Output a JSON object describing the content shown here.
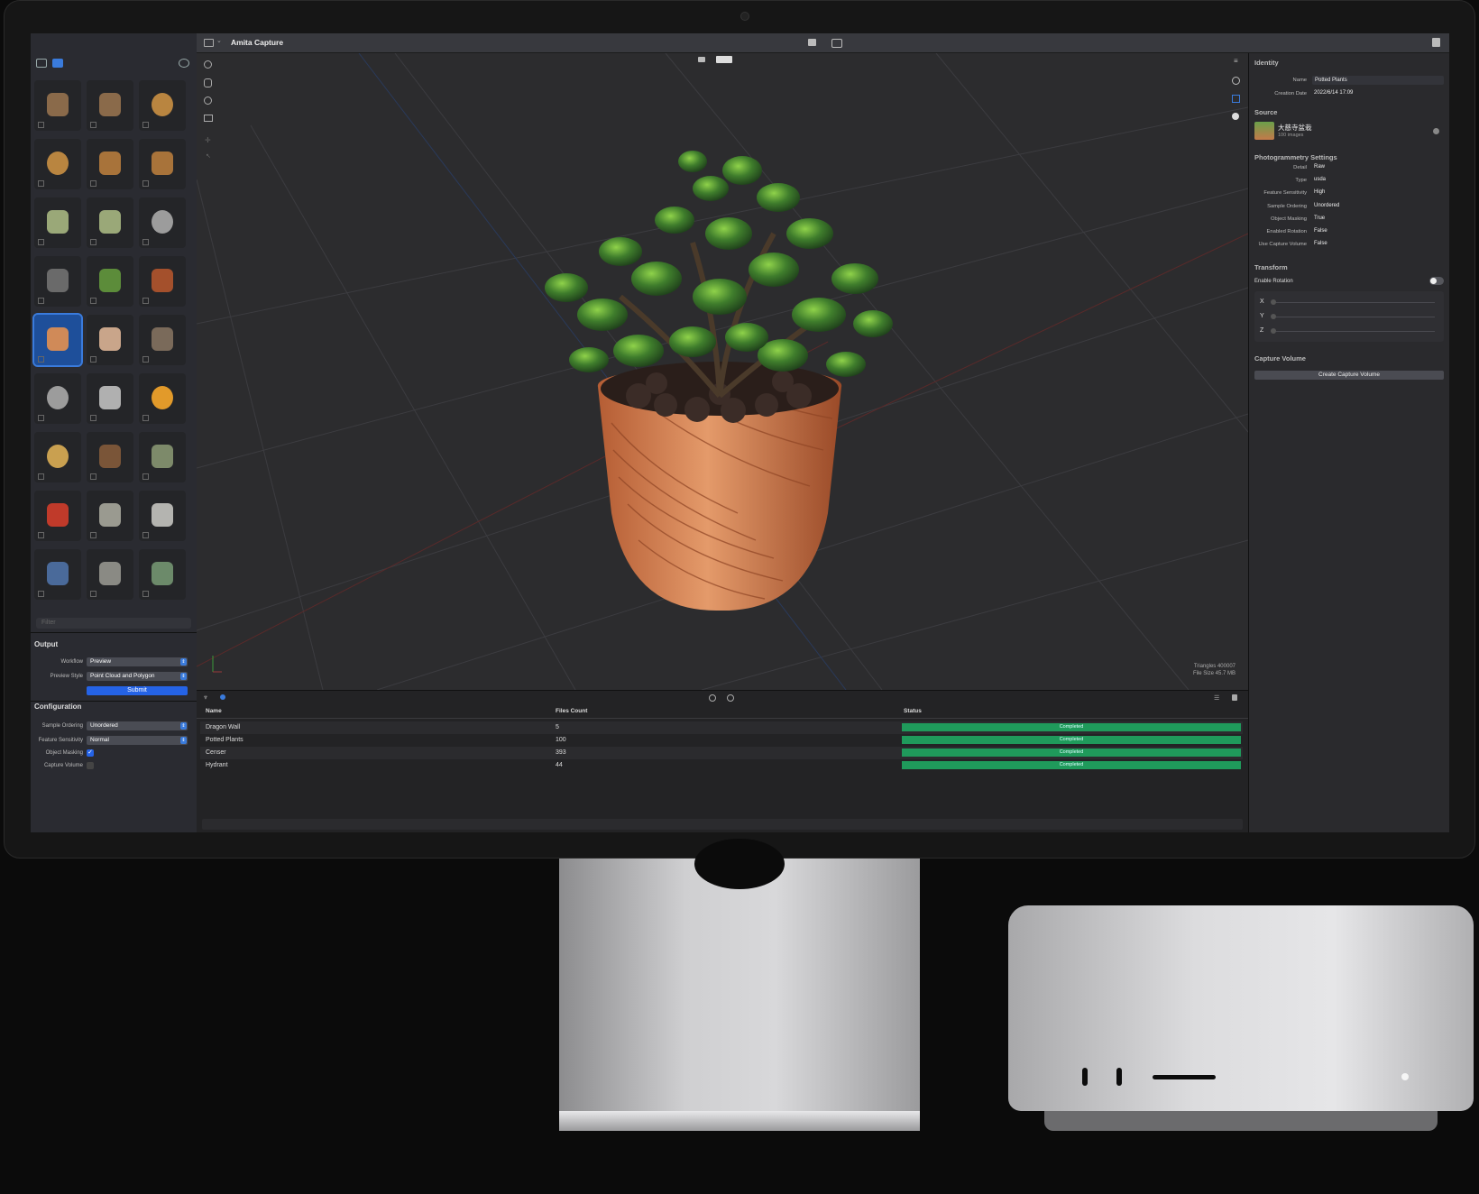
{
  "app": {
    "title": "Amita Capture"
  },
  "sidebar": {
    "filter_placeholder": "Filter",
    "thumbnails": [
      {
        "name": "boot"
      },
      {
        "name": "boot"
      },
      {
        "name": "bread"
      },
      {
        "name": "bread"
      },
      {
        "name": "baguette"
      },
      {
        "name": "baguette"
      },
      {
        "name": "frog"
      },
      {
        "name": "frog"
      },
      {
        "name": "dragon-plate"
      },
      {
        "name": "lantern"
      },
      {
        "name": "succulent"
      },
      {
        "name": "planter"
      },
      {
        "name": "potted-plants",
        "selected": true
      },
      {
        "name": "head-bust"
      },
      {
        "name": "train"
      },
      {
        "name": "dragon-plate"
      },
      {
        "name": "buddha"
      },
      {
        "name": "croissant"
      },
      {
        "name": "potato"
      },
      {
        "name": "wood-barrel"
      },
      {
        "name": "stone"
      },
      {
        "name": "traffic-cone"
      },
      {
        "name": "dragon-wall"
      },
      {
        "name": "censer"
      },
      {
        "name": "hydrant"
      },
      {
        "name": "lantern-tall"
      },
      {
        "name": "frog-statue"
      }
    ],
    "output": {
      "title": "Output",
      "workflow_label": "Workflow",
      "workflow_value": "Preview",
      "preview_style_label": "Preview Style",
      "preview_style_value": "Point Cloud and Polygon",
      "submit_label": "Submit"
    },
    "configuration": {
      "title": "Configuration",
      "sample_ordering_label": "Sample Ordering",
      "sample_ordering_value": "Unordered",
      "feature_sensitivity_label": "Feature Sensitivity",
      "feature_sensitivity_value": "Normal",
      "object_masking_label": "Object Masking",
      "object_masking_checked": true,
      "capture_volume_label": "Capture Volume",
      "capture_volume_checked": false
    }
  },
  "viewport": {
    "triangles_label": "Triangles",
    "triangles_value": "400007",
    "file_size_label": "File Size",
    "file_size_value": "45.7 MB"
  },
  "table": {
    "headers": {
      "name": "Name",
      "files": "Files Count",
      "status": "Status"
    },
    "rows": [
      {
        "name": "Dragon Wall",
        "files": "5",
        "status": "Completed",
        "progress": 1.0
      },
      {
        "name": "Potted Plants",
        "files": "100",
        "status": "Completed",
        "progress": 1.0
      },
      {
        "name": "Censer",
        "files": "393",
        "status": "Completed",
        "progress": 1.0
      },
      {
        "name": "Hydrant",
        "files": "44",
        "status": "Completed",
        "progress": 1.0
      }
    ]
  },
  "inspector": {
    "identity": {
      "title": "Identity",
      "name_label": "Name",
      "name_value": "Potted Plants",
      "creation_label": "Creation Date",
      "creation_value": "2022/6/14 17:09"
    },
    "source": {
      "title": "Source",
      "name": "大慈寺盆栽",
      "count": "100 images"
    },
    "photogrammetry": {
      "title": "Photogrammetry Settings",
      "items": [
        {
          "k": "Detail",
          "v": "Raw"
        },
        {
          "k": "Type",
          "v": "usda"
        },
        {
          "k": "Feature Sensitivity",
          "v": "High"
        },
        {
          "k": "Sample Ordering",
          "v": "Unordered"
        },
        {
          "k": "Object Masking",
          "v": "True"
        },
        {
          "k": "Enabled Rotation",
          "v": "False"
        },
        {
          "k": "Use Capture Volume",
          "v": "False"
        }
      ]
    },
    "transform": {
      "title": "Transform",
      "enable_rotation_label": "Enable Rotation",
      "enable_rotation_on": false,
      "axes": [
        "X",
        "Y",
        "Z"
      ]
    },
    "capture_volume": {
      "title": "Capture Volume",
      "button_label": "Create Capture Volume"
    }
  },
  "colors": {
    "accent": "#2563e6",
    "progress": "#1f9a5b"
  }
}
